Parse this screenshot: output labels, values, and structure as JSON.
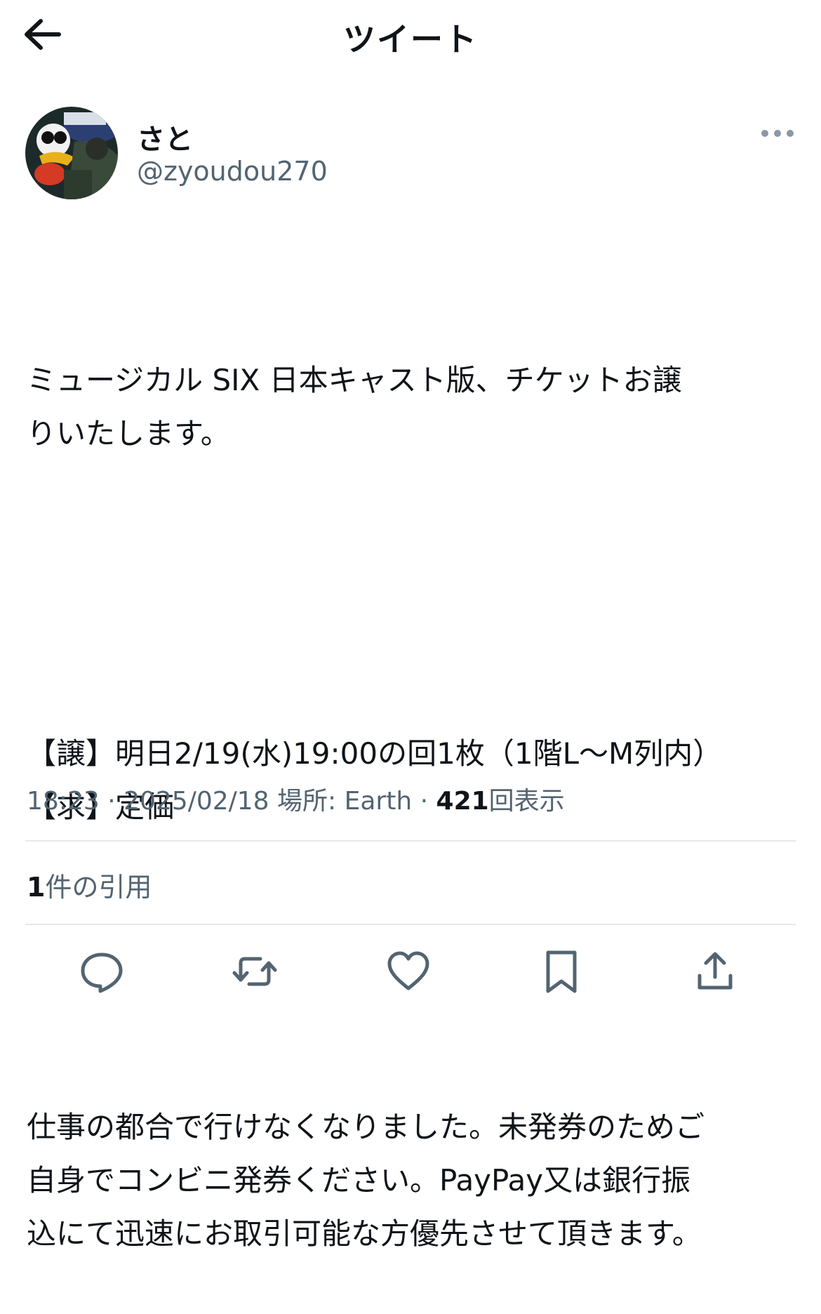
{
  "header": {
    "title": "ツイート",
    "back_icon": "arrow-left-icon"
  },
  "author": {
    "name": "さと",
    "handle": "@zyoudou270",
    "avatar_icon": "avatar-image"
  },
  "tweet": {
    "paragraphs": [
      "ミュージカル SIX 日本キャスト版、チケットお譲\nりいたします。",
      "【譲】明日2/19(水)19:00の回1枚（1階L〜M列内）\n【求】定価",
      "仕事の都合で行けなくなりました。未発券のためご\n自身でコンビニ発券ください。PayPay又は銀行振\n込にて迅速にお取引可能な方優先させて頂きます。"
    ]
  },
  "meta": {
    "time": "18:23",
    "sep1": " · ",
    "date": "2025/02/18",
    "location": "場所: Earth",
    "sep2": " · ",
    "views_count": "421",
    "views_label": "回表示"
  },
  "quotes": {
    "count": "1",
    "label": "件の引用"
  },
  "actions": [
    "reply-icon",
    "retweet-icon",
    "like-icon",
    "bookmark-icon",
    "share-icon"
  ],
  "colors": {
    "text": "#0f1419",
    "secondary": "#536471",
    "divider": "#e7e9ea"
  }
}
